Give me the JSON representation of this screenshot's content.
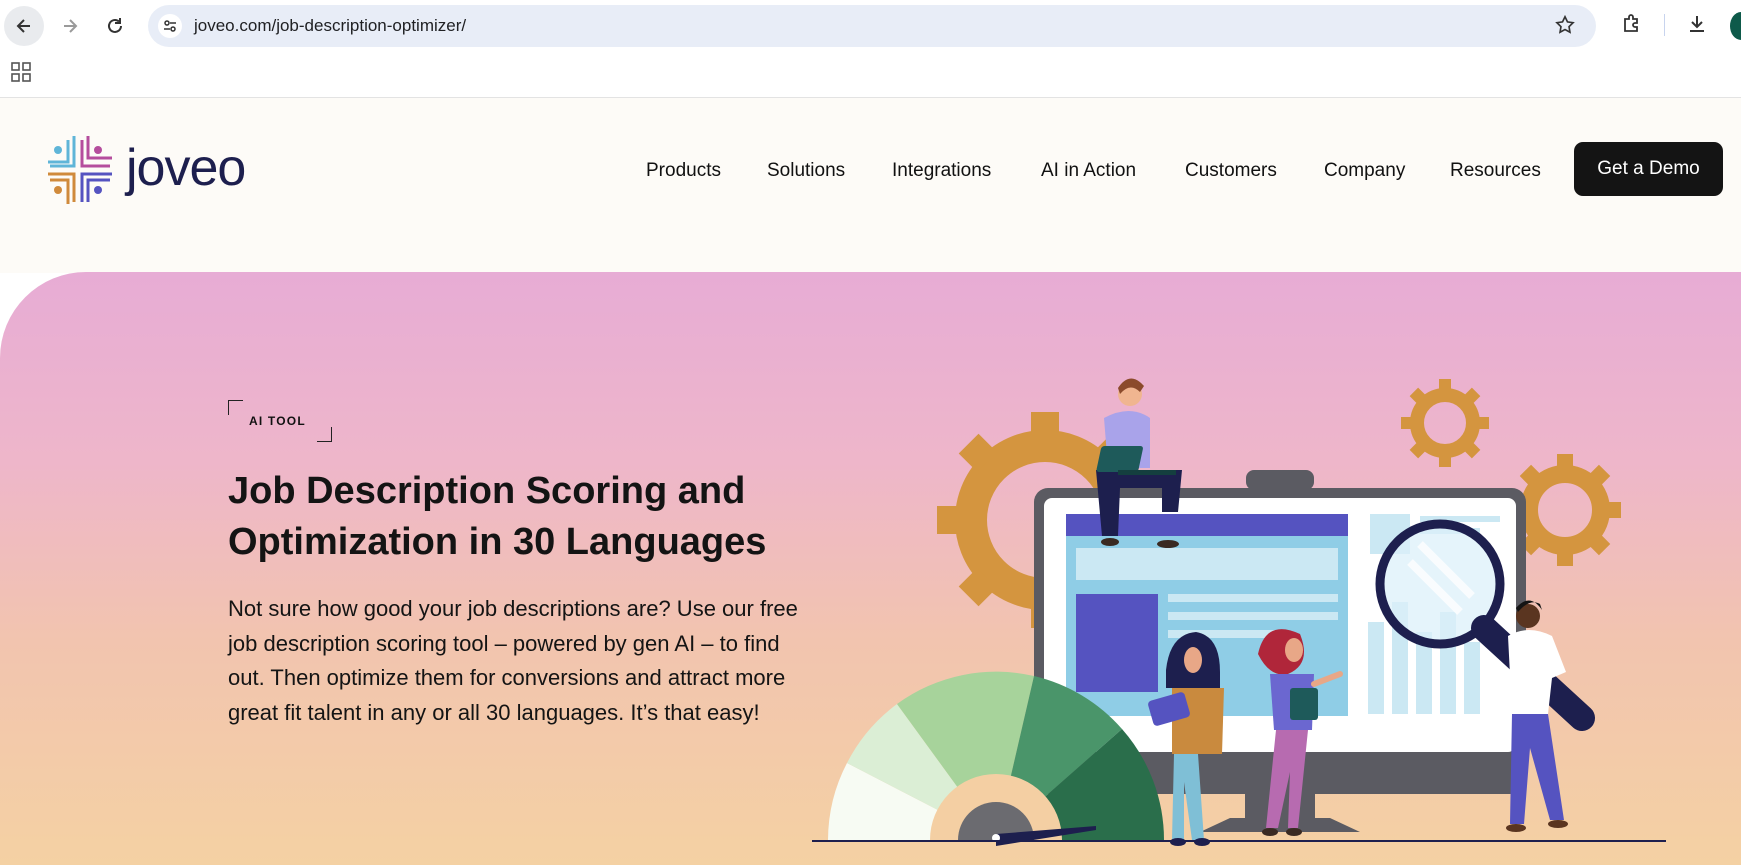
{
  "browser": {
    "url": "joveo.com/job-description-optimizer/",
    "icons": [
      "back-arrow-icon",
      "forward-arrow-icon",
      "reload-icon",
      "site-settings-icon",
      "bookmark-star-icon",
      "extensions-icon",
      "download-icon",
      "profile-avatar",
      "apps-grid-icon"
    ]
  },
  "site": {
    "logo_text": "joveo",
    "nav": [
      "Products",
      "Solutions",
      "Integrations",
      "AI in Action",
      "Customers",
      "Company",
      "Resources"
    ],
    "cta": "Get a Demo"
  },
  "hero": {
    "tag": "AI TOOL",
    "headline": "Job Description Scoring and Optimization in 30 Languages",
    "lead": "Not sure how good your job descriptions are? Use our free job description scoring tool – powered by gen AI – to find out. Then optimize them for conversions and attract more great fit talent in any or all 30 languages. It’s that easy!"
  },
  "colors": {
    "brand_navy": "#1d1f4e",
    "cta_bg": "#141414",
    "hero_top": "#e7acd5",
    "hero_bottom": "#f4d1a3",
    "gear": "#d4953f",
    "monitor_accent": "#5553c0"
  }
}
